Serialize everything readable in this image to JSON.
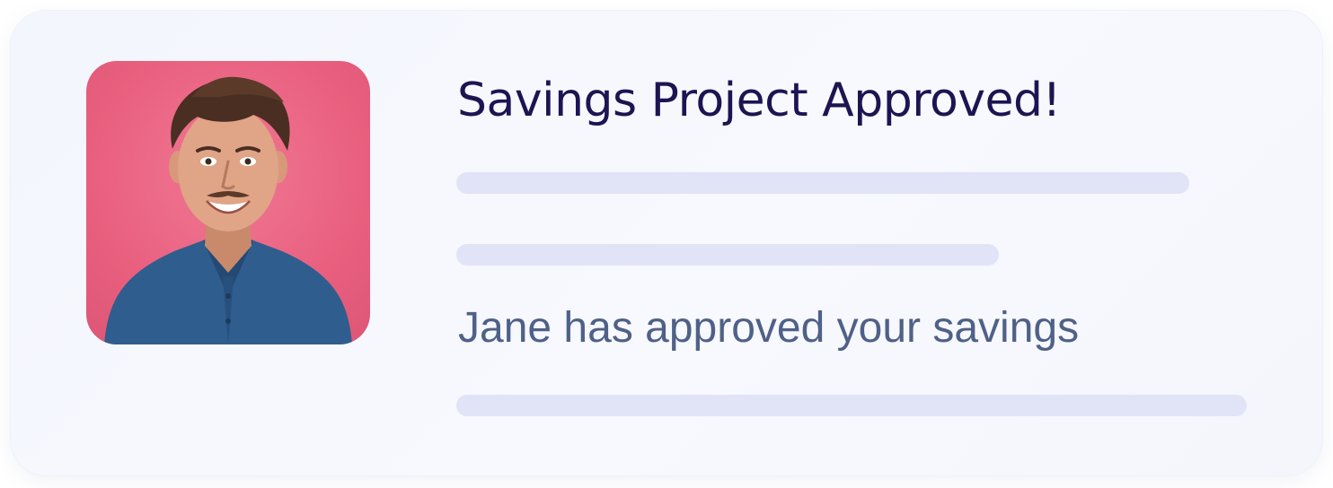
{
  "notification": {
    "title": "Savings Project Approved!",
    "message": "Jane has approved your savings",
    "avatar_icon": "person-portrait-icon",
    "colors": {
      "title": "#1e1452",
      "message": "#4f6188",
      "placeholder_bar": "#e1e3f7",
      "avatar_background": "#e9607f"
    }
  }
}
